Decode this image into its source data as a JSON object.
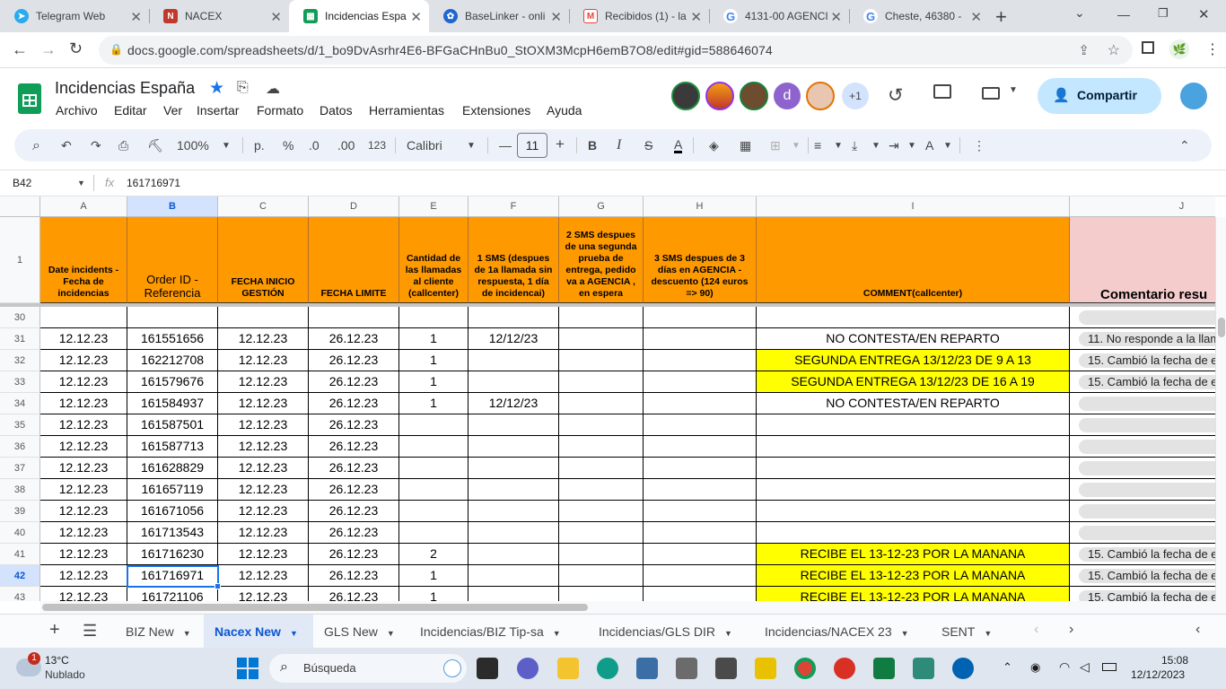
{
  "browser": {
    "tabs": [
      {
        "title": "Telegram Web",
        "icon": "telegram-icon",
        "color": "#2aabee"
      },
      {
        "title": "NACEX",
        "icon": "nacex-icon",
        "color": "#c0392b"
      },
      {
        "title": "Incidencias Espa",
        "icon": "sheets-icon",
        "color": "#0f9d58"
      },
      {
        "title": "BaseLinker - onli",
        "icon": "baselinker-icon",
        "color": "#1e66d0"
      },
      {
        "title": "Recibidos (1) - la",
        "icon": "gmail-icon",
        "color": "#ea4335"
      },
      {
        "title": "4131-00 AGENCI",
        "icon": "google-icon",
        "color": "#4285f4"
      },
      {
        "title": "Cheste, 46380 - ",
        "icon": "google-icon",
        "color": "#4285f4"
      }
    ],
    "url": "docs.google.com/spreadsheets/d/1_bo9DvAsrhr4E6-BFGaCHnBu0_StOXM3McpH6emB7O8/edit#gid=588646074"
  },
  "doc": {
    "title": "Incidencias España",
    "menus": [
      "Archivo",
      "Editar",
      "Ver",
      "Insertar",
      "Formato",
      "Datos",
      "Herramientas",
      "Extensiones",
      "Ayuda"
    ],
    "avatar_letter": "d",
    "avatar_more": "+1",
    "share_label": "Compartir"
  },
  "ribbon": {
    "zoom": "100%",
    "currency": "p.",
    "percent": "%",
    "dec_less": ".0",
    "dec_more": ".00",
    "format_123": "123",
    "font": "Calibri",
    "font_size": "11",
    "bold": "B",
    "italic": "I",
    "text_color": "A"
  },
  "formula_bar": {
    "cell_ref": "B42",
    "fx": "fx",
    "value": "161716971"
  },
  "columns": [
    "A",
    "B",
    "C",
    "D",
    "E",
    "F",
    "G",
    "H",
    "I",
    "J"
  ],
  "header_row_num": "1",
  "header": [
    "Date incidents - Fecha de incidencias",
    "Order ID - Referencia",
    "FECHA INICIO GESTIÓN",
    "FECHA LIMITE",
    "Cantidad de las llamadas al cliente (callcenter)",
    "1 SMS (despues de 1a llamada sin respuesta, 1 día de incidencai)",
    "2 SMS despues de una segunda prueba de entrega, pedido va a AGENCIA , en espera",
    "3 SMS despues de 3 días en AGENCIA - descuento (124 euros => 90)",
    "COMMENT(callcenter)",
    "Comentario resu"
  ],
  "rows": [
    {
      "n": "30",
      "a": "",
      "b": "",
      "c": "",
      "d": "",
      "e": "",
      "f": "",
      "i": "",
      "j": ""
    },
    {
      "n": "31",
      "a": "12.12.23",
      "b": "161551656",
      "c": "12.12.23",
      "d": "26.12.23",
      "e": "1",
      "f": "12/12/23",
      "i": "NO CONTESTA/EN REPARTO",
      "j": "11. No responde a la llam"
    },
    {
      "n": "32",
      "a": "12.12.23",
      "b": "162212708",
      "c": "12.12.23",
      "d": "26.12.23",
      "e": "1",
      "f": "",
      "i": "SEGUNDA ENTREGA 13/12/23 DE 9 A 13",
      "j": "15. Cambió la fecha de e"
    },
    {
      "n": "33",
      "a": "12.12.23",
      "b": "161579676",
      "c": "12.12.23",
      "d": "26.12.23",
      "e": "1",
      "f": "",
      "i": "SEGUNDA ENTREGA 13/12/23 DE 16 A 19",
      "j": "15. Cambió la fecha de e"
    },
    {
      "n": "34",
      "a": "12.12.23",
      "b": "161584937",
      "c": "12.12.23",
      "d": "26.12.23",
      "e": "1",
      "f": "12/12/23",
      "i": "NO CONTESTA/EN REPARTO",
      "j": ""
    },
    {
      "n": "35",
      "a": "12.12.23",
      "b": "161587501",
      "c": "12.12.23",
      "d": "26.12.23",
      "e": "",
      "f": "",
      "i": "",
      "j": ""
    },
    {
      "n": "36",
      "a": "12.12.23",
      "b": "161587713",
      "c": "12.12.23",
      "d": "26.12.23",
      "e": "",
      "f": "",
      "i": "",
      "j": ""
    },
    {
      "n": "37",
      "a": "12.12.23",
      "b": "161628829",
      "c": "12.12.23",
      "d": "26.12.23",
      "e": "",
      "f": "",
      "i": "",
      "j": ""
    },
    {
      "n": "38",
      "a": "12.12.23",
      "b": "161657119",
      "c": "12.12.23",
      "d": "26.12.23",
      "e": "",
      "f": "",
      "i": "",
      "j": ""
    },
    {
      "n": "39",
      "a": "12.12.23",
      "b": "161671056",
      "c": "12.12.23",
      "d": "26.12.23",
      "e": "",
      "f": "",
      "i": "",
      "j": ""
    },
    {
      "n": "40",
      "a": "12.12.23",
      "b": "161713543",
      "c": "12.12.23",
      "d": "26.12.23",
      "e": "",
      "f": "",
      "i": "",
      "j": ""
    },
    {
      "n": "41",
      "a": "12.12.23",
      "b": "161716230",
      "c": "12.12.23",
      "d": "26.12.23",
      "e": "2",
      "f": "",
      "i": "RECIBE EL 13-12-23 POR LA MANANA",
      "j": "15. Cambió la fecha de e"
    },
    {
      "n": "42",
      "a": "12.12.23",
      "b": "161716971",
      "c": "12.12.23",
      "d": "26.12.23",
      "e": "1",
      "f": "",
      "i": "RECIBE EL 13-12-23 POR LA MANANA",
      "j": "15. Cambió la fecha de e"
    },
    {
      "n": "43",
      "a": "12.12.23",
      "b": "161721106",
      "c": "12.12.23",
      "d": "26.12.23",
      "e": "1",
      "f": "",
      "i": "RECIBE EL 13-12-23 POR LA MANANA",
      "j": "15. Cambió la fecha de e"
    }
  ],
  "sheet_tabs": [
    "BIZ New",
    "Nacex New",
    "GLS New",
    "Incidencias/BIZ Tip-sa",
    "Incidencias/GLS DIR",
    "Incidencias/NACEX 23",
    "SENT"
  ],
  "active_sheet": "Nacex New",
  "taskbar": {
    "weather_temp": "13°C",
    "weather_desc": "Nublado",
    "weather_badge": "1",
    "search_placeholder": "Búsqueda",
    "time": "15:08",
    "date": "12/12/2023"
  },
  "colors": {
    "header_orange": "#ff9900",
    "highlight_yellow": "#ffff00",
    "accent_blue": "#0b57d0",
    "share_bg": "#c2e7ff"
  }
}
